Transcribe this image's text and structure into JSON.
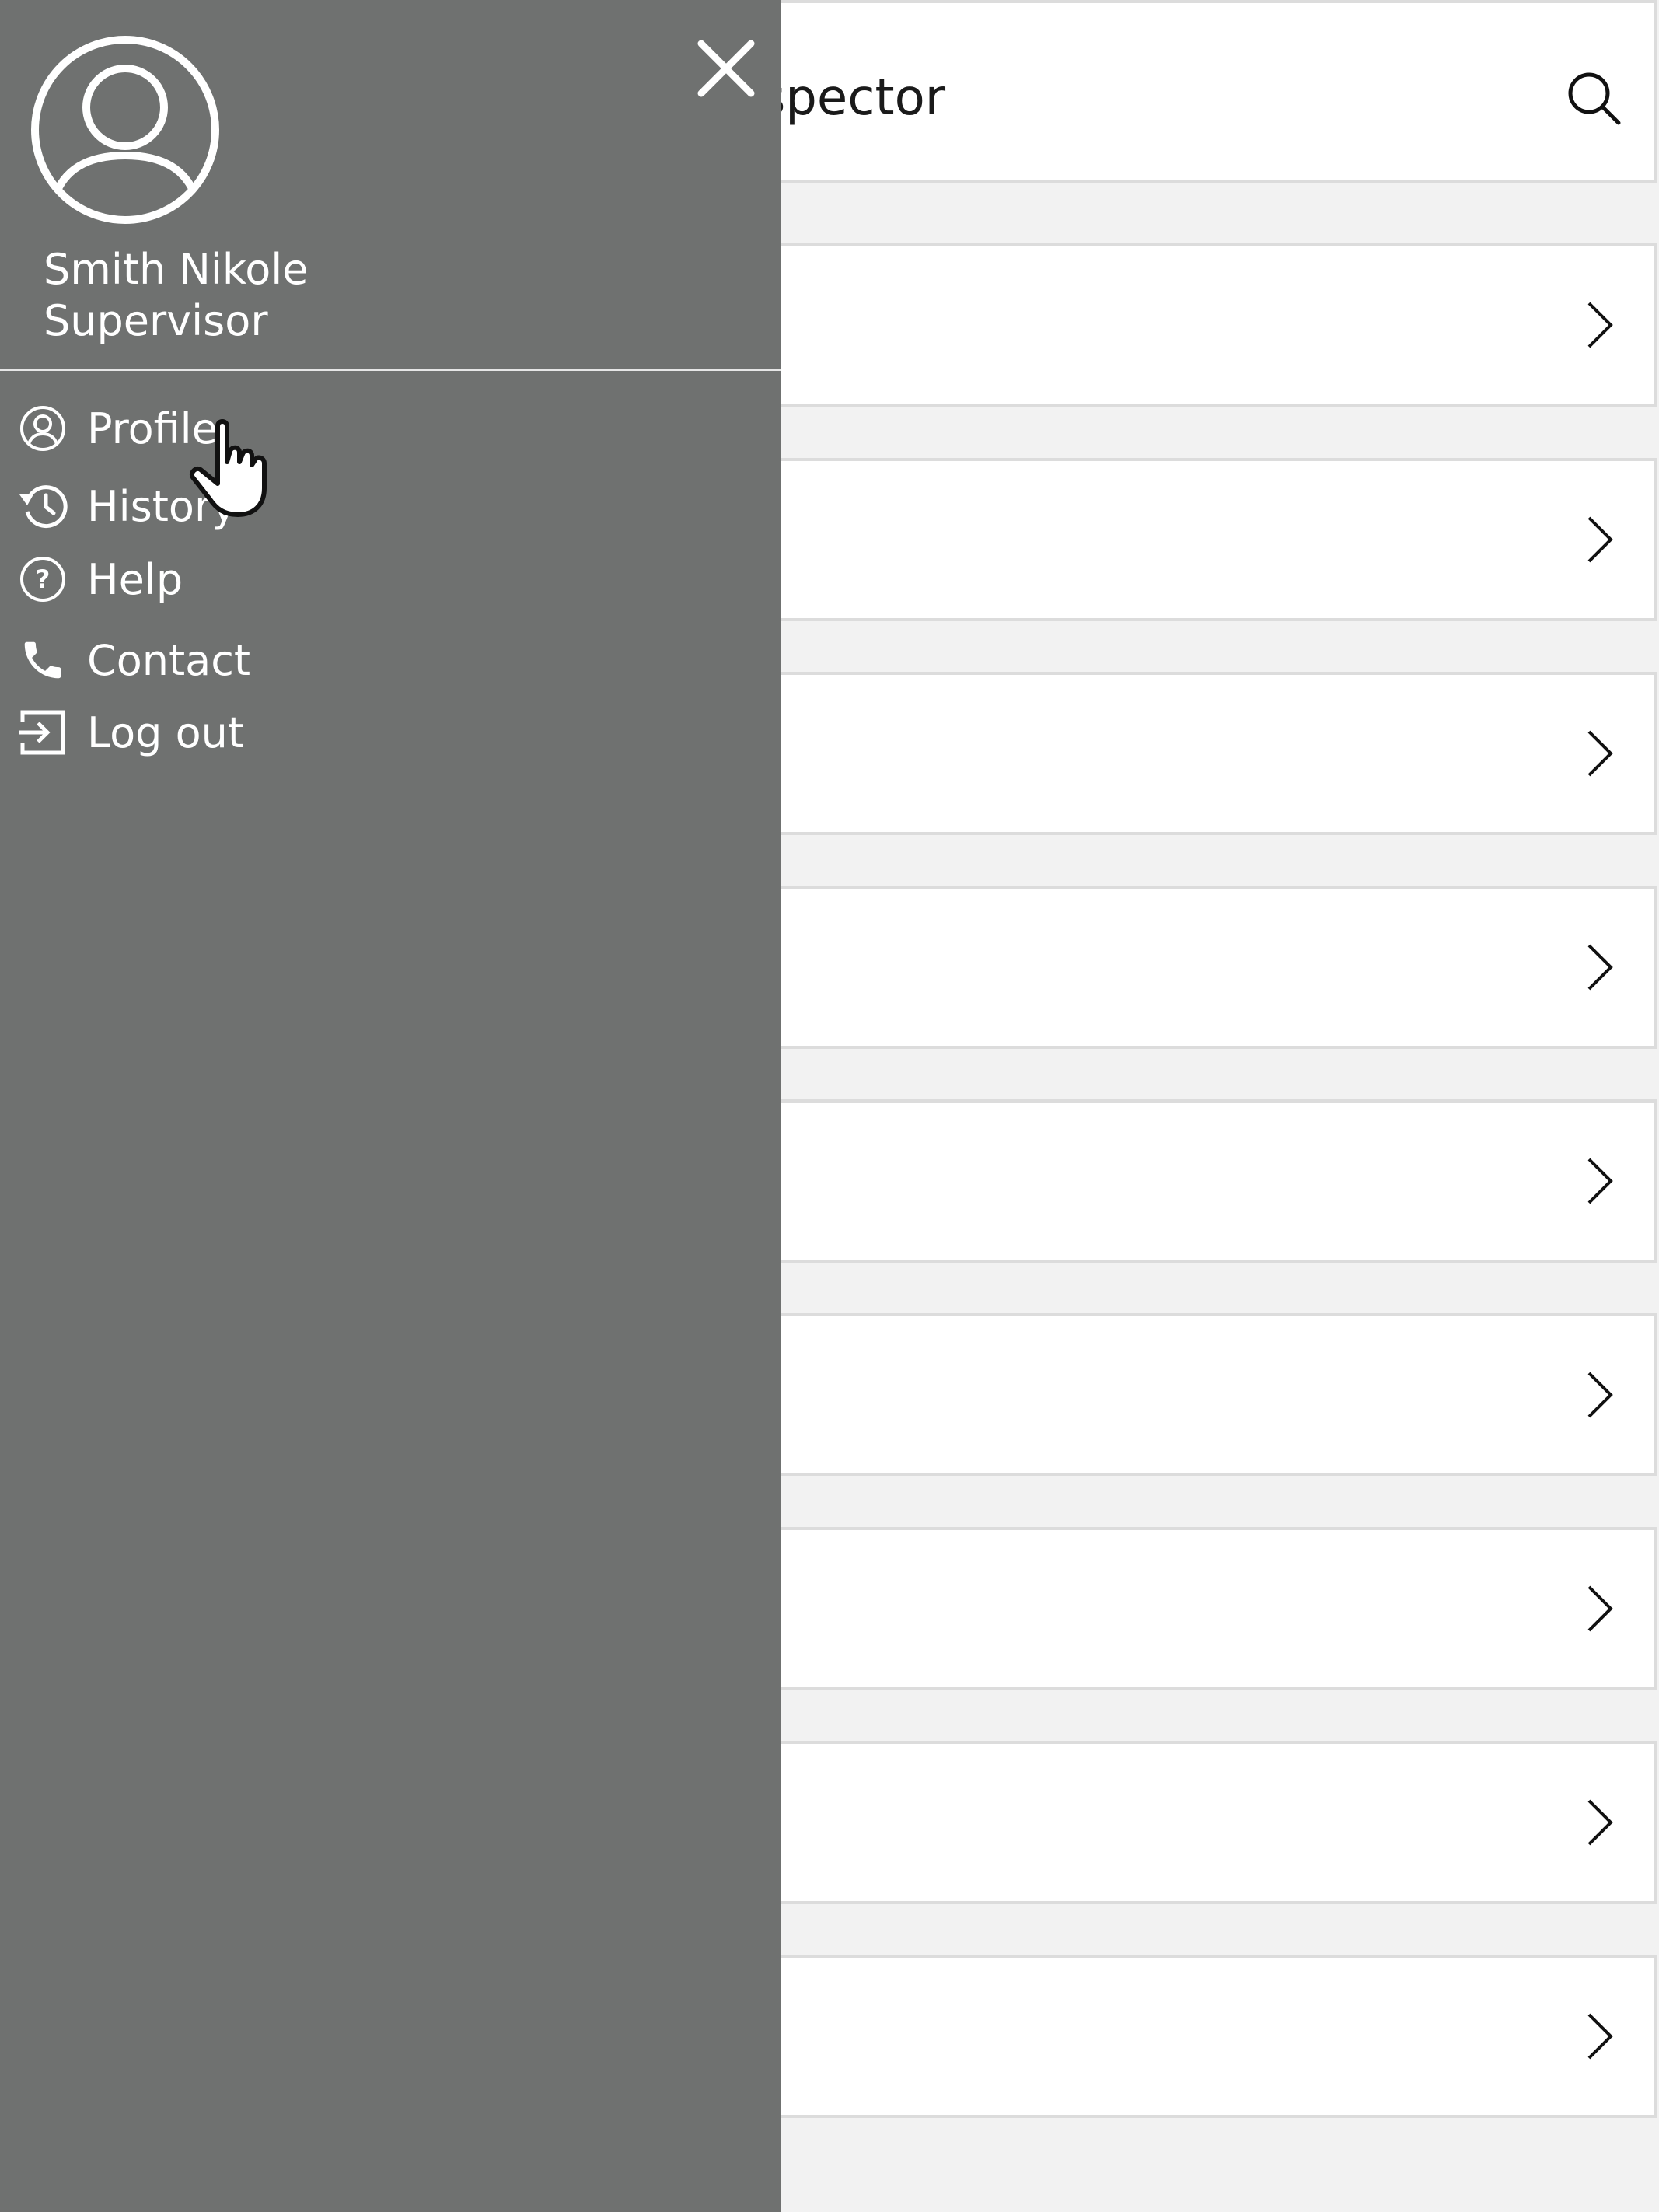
{
  "header": {
    "title": "le Inspector",
    "search_icon": "search-icon"
  },
  "list": {
    "row_count": 9,
    "chevron_icon": "chevron-right-icon"
  },
  "drawer": {
    "close_icon": "close-icon",
    "avatar_icon": "user-avatar-icon",
    "user": {
      "name": "Smith Nikole",
      "role": "Supervisor"
    },
    "menu": [
      {
        "label": "Profile",
        "icon": "profile-icon"
      },
      {
        "label": "History",
        "icon": "history-icon"
      },
      {
        "label": "Help",
        "icon": "help-icon"
      },
      {
        "label": "Contact",
        "icon": "phone-icon"
      },
      {
        "label": "Log out",
        "icon": "logout-icon"
      }
    ]
  },
  "colors": {
    "drawer_background": "#6f7170",
    "page_background": "#f2f2f2",
    "card_background": "#ffffff",
    "card_border": "#dcdcdc",
    "drawer_text": "#ffffff"
  }
}
